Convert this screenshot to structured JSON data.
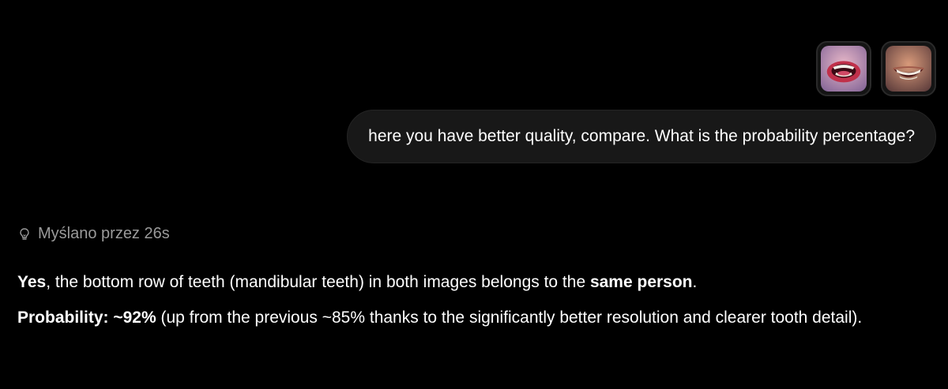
{
  "attachments": [
    {
      "icon": "open-mouth-teeth-photo"
    },
    {
      "icon": "smiling-mouth-teeth-photo"
    }
  ],
  "user_message": {
    "text": "here you have better quality, compare. What is the probability percentage?"
  },
  "assistant": {
    "thinking_icon": "lightbulb-icon",
    "thinking_label": "Myślano przez 26s",
    "paragraph1": {
      "bold_yes": "Yes",
      "text_a": ", the bottom row of teeth (mandibular teeth) in both images belongs to the ",
      "bold_same": "same person",
      "text_b": "."
    },
    "paragraph2": {
      "bold_prob": "Probability: ~92%",
      "text": " (up from the previous ~85% thanks to the significantly better resolution and clearer tooth detail)."
    }
  },
  "colors": {
    "background": "#000000",
    "bubble": "#181818",
    "muted_text": "#9a9a9a",
    "text": "#ffffff"
  }
}
